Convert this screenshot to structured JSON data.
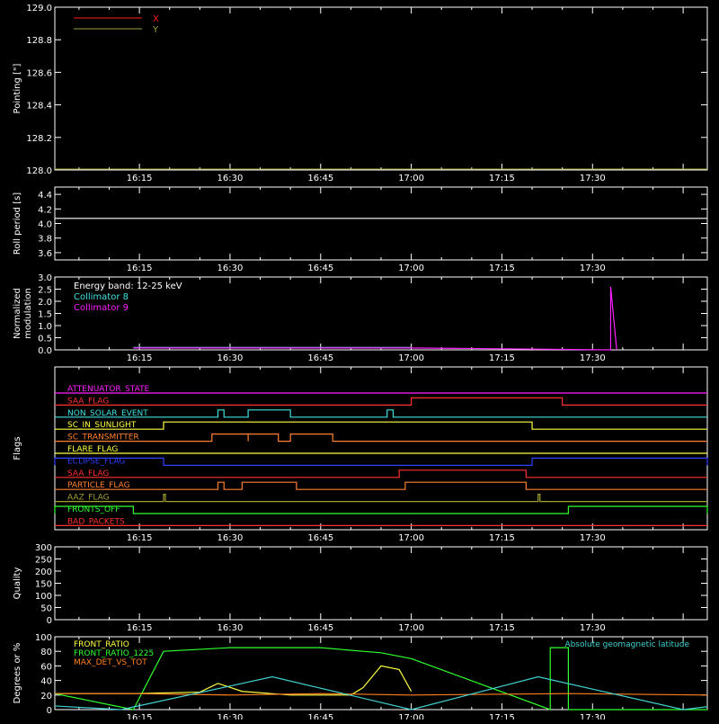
{
  "chart_data": [
    {
      "type": "line",
      "ylabel": "Pointing [\"]",
      "ylim": [
        128.0,
        129.0
      ],
      "yticks": [
        "129.0",
        "128.8",
        "128.6",
        "128.4",
        "128.2",
        "128.0"
      ],
      "xticks": [
        "16:15",
        "16:30",
        "16:45",
        "17:00",
        "17:15",
        "17:30"
      ],
      "series": [
        {
          "name": "X",
          "color": "#ff2020",
          "values": []
        },
        {
          "name": "Y",
          "color": "#a0a030",
          "values": []
        }
      ]
    },
    {
      "type": "line",
      "ylabel": "Roll period [s]",
      "ylim": [
        3.5,
        4.5
      ],
      "yticks": [
        "4.4",
        "4.2",
        "4.0",
        "3.8",
        "3.6"
      ],
      "xticks": [
        "16:15",
        "16:30",
        "16:45",
        "17:00",
        "17:15",
        "17:30"
      ],
      "series": [
        {
          "color": "#ffffff",
          "x": [
            "16:01",
            "17:49"
          ],
          "values": [
            4.07,
            4.07
          ]
        }
      ]
    },
    {
      "type": "line",
      "ylabel": "Normalized modulation",
      "ylim": [
        0.0,
        3.0
      ],
      "yticks": [
        "3.0",
        "2.5",
        "2.0",
        "1.5",
        "1.0",
        "0.5",
        "0.0"
      ],
      "xticks": [
        "16:15",
        "16:30",
        "16:45",
        "17:00",
        "17:15",
        "17:30"
      ],
      "annotation": "Energy band: 12-25 keV",
      "series": [
        {
          "name": "Collimator 8",
          "color": "#40e0e0",
          "x": [
            "16:14",
            "17:00"
          ],
          "values": [
            0.1,
            0.1
          ]
        },
        {
          "name": "Collimator 9",
          "color": "#ff20ff",
          "x": [
            "16:14",
            "17:00",
            "17:33",
            "17:33",
            "17:34"
          ],
          "values": [
            0.08,
            0.08,
            0.0,
            2.6,
            0.0
          ]
        }
      ]
    },
    {
      "type": "line",
      "ylabel": "Flags",
      "xticks": [
        "16:15",
        "16:30",
        "16:45",
        "17:00",
        "17:15",
        "17:30"
      ],
      "flags": [
        {
          "name": "ATTENUATOR_STATE",
          "color": "#ff20ff",
          "segments": []
        },
        {
          "name": "SAA_FLAG",
          "color": "#ff3030",
          "segments": [
            [
              "17:00",
              "17:25"
            ]
          ]
        },
        {
          "name": "NON_SOLAR_EVENT",
          "color": "#40e0e0",
          "segments": [
            [
              "16:28",
              "16:29"
            ],
            [
              "16:33",
              "16:40"
            ],
            [
              "16:56",
              "16:57"
            ]
          ]
        },
        {
          "name": "SC_IN_SUNLIGHT",
          "color": "#ffff40",
          "segments": [
            [
              "16:19",
              "17:20"
            ]
          ]
        },
        {
          "name": "SC_TRANSMITTER",
          "color": "#ff8030",
          "segments": [
            [
              "16:27",
              "16:33"
            ],
            [
              "16:33",
              "16:38"
            ],
            [
              "16:40",
              "16:47"
            ]
          ]
        },
        {
          "name": "FLARE_FLAG",
          "color": "#ffff40",
          "segments": []
        },
        {
          "name": "ECLIPSE_FLAG",
          "color": "#3040ff",
          "segments": [
            [
              "16:01",
              "16:19"
            ],
            [
              "17:20",
              "17:49"
            ]
          ]
        },
        {
          "name": "SAA_FLAG",
          "color": "#ff3030",
          "segments": [
            [
              "16:58",
              "17:19"
            ]
          ]
        },
        {
          "name": "PARTICLE_FLAG",
          "color": "#ff8030",
          "segments": [
            [
              "16:28",
              "16:29"
            ],
            [
              "16:32",
              "16:41"
            ],
            [
              "16:59",
              "17:19"
            ]
          ]
        },
        {
          "name": "AAZ_FLAG",
          "color": "#a0a030",
          "segments": [
            [
              "16:19",
              "16:19"
            ],
            [
              "17:21",
              "17:21"
            ]
          ]
        },
        {
          "name": "FRONTS_OFF",
          "color": "#30ff30",
          "segments": [
            [
              "16:01",
              "16:14"
            ],
            [
              "17:26",
              "17:49"
            ]
          ]
        },
        {
          "name": "BAD_PACKETS",
          "color": "#ff3030",
          "segments": []
        }
      ]
    },
    {
      "type": "line",
      "ylabel": "Quality",
      "ylim": [
        0,
        300
      ],
      "yticks": [
        "300",
        "250",
        "200",
        "150",
        "100",
        "50",
        "0"
      ],
      "xticks": [
        "16:15",
        "16:30",
        "16:45",
        "17:00",
        "17:15",
        "17:30"
      ],
      "series": [
        {
          "color": "#ffffff",
          "values": []
        }
      ]
    },
    {
      "type": "line",
      "ylabel": "Degrees or %",
      "ylim": [
        0,
        100
      ],
      "yticks": [
        "100",
        "80",
        "60",
        "40",
        "20",
        "0"
      ],
      "xticks": [
        "16:15",
        "16:30",
        "16:45",
        "17:00",
        "17:15",
        "17:30"
      ],
      "annotation": "Absolute geomagnetic latitude",
      "series": [
        {
          "name": "FRONT_RATIO",
          "color": "#ffff40",
          "x": [
            "16:01",
            "16:14",
            "16:25",
            "16:28",
            "16:32",
            "16:40",
            "16:45",
            "16:50",
            "16:52",
            "16:55",
            "16:58",
            "17:00"
          ],
          "values": [
            22,
            22,
            24,
            36,
            25,
            20,
            20,
            20,
            30,
            60,
            55,
            25
          ]
        },
        {
          "name": "FRONT_RATIO_1225",
          "color": "#30ff30",
          "x": [
            "16:01",
            "16:14",
            "16:19",
            "16:30",
            "16:45",
            "16:52",
            "16:55",
            "17:00",
            "17:23",
            "17:23",
            "17:26",
            "17:26",
            "17:49"
          ],
          "values": [
            22,
            0,
            80,
            85,
            85,
            80,
            78,
            70,
            0,
            85,
            85,
            0,
            0
          ]
        },
        {
          "name": "MAX_DET_VS_TOT",
          "color": "#ff8020",
          "x": [
            "16:01",
            "16:14",
            "16:30",
            "16:45",
            "17:00",
            "17:26",
            "17:49"
          ],
          "values": [
            22,
            22,
            20,
            22,
            20,
            22,
            20
          ]
        },
        {
          "name": "Absolute geomagnetic latitude",
          "color": "#40d0d0",
          "x": [
            "16:01",
            "16:12",
            "16:37",
            "17:00",
            "17:21",
            "17:45",
            "17:49"
          ],
          "values": [
            5,
            0,
            45,
            0,
            45,
            0,
            4
          ]
        }
      ]
    }
  ]
}
